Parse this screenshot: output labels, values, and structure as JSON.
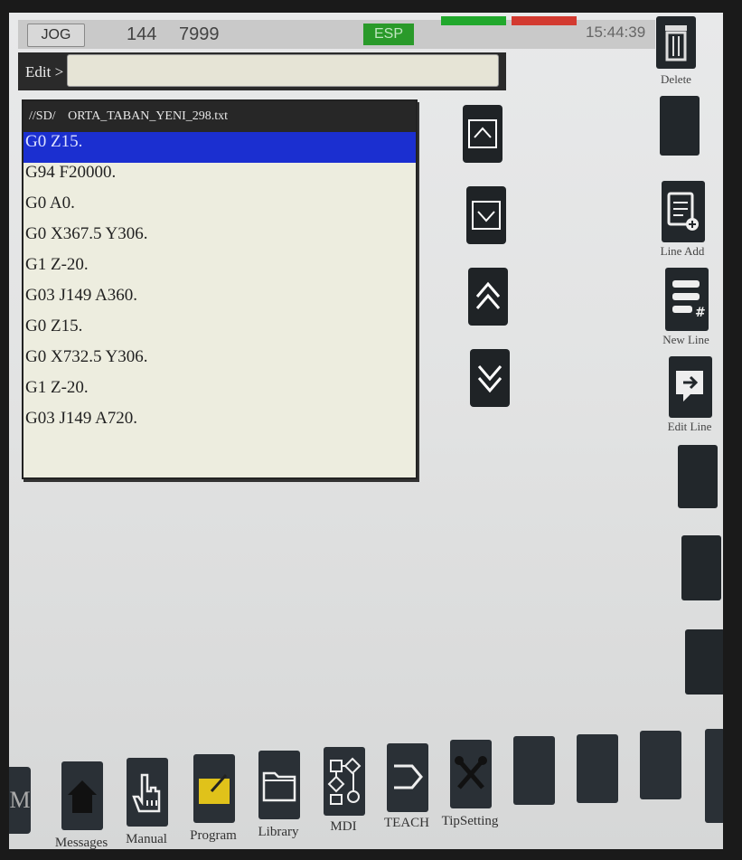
{
  "status": {
    "mode": "JOG",
    "value_a": "144",
    "value_b": "7999",
    "esp_label": "ESP",
    "time": "15:44:39"
  },
  "edit": {
    "label": "Edit >",
    "value": ""
  },
  "file": {
    "path": "//SD/",
    "name": "ORTA_TABAN_YENI_298.txt",
    "lines": [
      "G0 Z15.",
      "G94 F20000.",
      "G0 A0.",
      "G0 X367.5 Y306.",
      "G1 Z-20.",
      "G03 J149 A360.",
      "G0 Z15.",
      "G0 X732.5 Y306.",
      "G1 Z-20.",
      "G03 J149 A720."
    ],
    "selected_index": 0
  },
  "side": {
    "delete": "Delete",
    "line_add": "Line Add",
    "new_line": "New Line",
    "edit_line": "Edit Line"
  },
  "bottom": {
    "m_label": "M",
    "messages": "Messages",
    "manual": "Manual",
    "program": "Program",
    "library": "Library",
    "mdi": "MDI",
    "teach": "TEACH",
    "tipsetting": "TipSetting"
  },
  "colors": {
    "selection": "#1b2fd0",
    "esp_green": "#2a9a2a",
    "alarm_red": "#d33a30",
    "program_yellow": "#e0c21a"
  }
}
